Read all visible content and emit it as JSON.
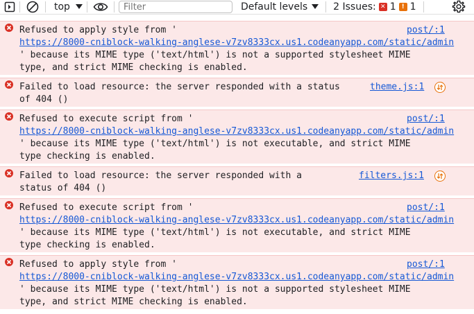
{
  "toolbar": {
    "context": "top",
    "filter_placeholder": "Filter",
    "levels_label": "Default levels",
    "issues_label": "2 Issues:",
    "issues_error_count": "1",
    "issues_warning_count": "1"
  },
  "messages": [
    {
      "lines": [
        "Refused to apply style from '",
        "https://8000-cniblock-walking-anglese-v7zv8333cx.us1.codeanyapp.com/static/admin",
        "' because its MIME type ('text/html') is not a supported stylesheet MIME",
        "type, and strict MIME checking is enabled."
      ],
      "source": "post/:1"
    },
    {
      "lines": [
        "Failed to load resource: the server responded with a status",
        "of 404 ()"
      ],
      "source": "theme.js:1"
    },
    {
      "lines": [
        "Refused to execute script from '",
        "https://8000-cniblock-walking-anglese-v7zv8333cx.us1.codeanyapp.com/static/admin",
        "' because its MIME type ('text/html') is not executable, and strict MIME",
        "type checking is enabled."
      ],
      "source": "post/:1"
    },
    {
      "lines": [
        "Failed to load resource: the server responded with a",
        "status of 404 ()"
      ],
      "source": "filters.js:1"
    },
    {
      "lines": [
        "Refused to execute script from '",
        "https://8000-cniblock-walking-anglese-v7zv8333cx.us1.codeanyapp.com/static/admin",
        "' because its MIME type ('text/html') is not executable, and strict MIME",
        "type checking is enabled."
      ],
      "source": "post/:1"
    },
    {
      "lines": [
        "Refused to apply style from '",
        "https://8000-cniblock-walking-anglese-v7zv8333cx.us1.codeanyapp.com/static/admin",
        "' because its MIME type ('text/html') is not a supported stylesheet MIME",
        "type, and strict MIME checking is enabled."
      ],
      "source": "post/:1"
    }
  ]
}
